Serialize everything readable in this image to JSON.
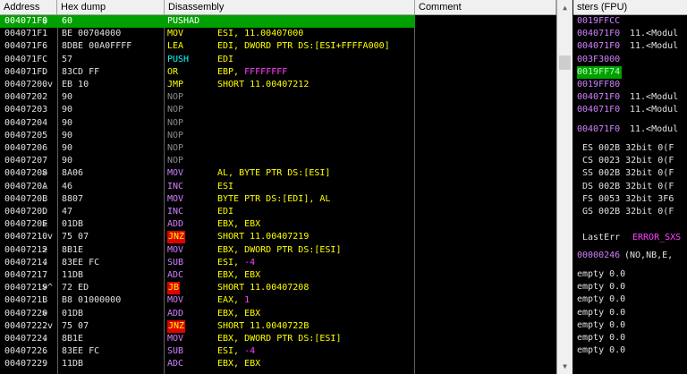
{
  "headers": {
    "address": "Address",
    "hex": "Hex dump",
    "disasm": "Disassembly",
    "comment": "Comment",
    "registers": "sters (FPU)"
  },
  "rows": [
    {
      "addr": "004071F0",
      "jmp": "$",
      "hex": "60",
      "mn": "PUSHAD",
      "mn_style": "white",
      "op": "",
      "op_style": "white",
      "selected": true
    },
    {
      "addr": "004071F1",
      "jmp": ".",
      "hex": "BE 00704000",
      "mn": "MOV",
      "mn_style": "yellow",
      "op": "ESI, 11.00407000",
      "op_style": "yellow"
    },
    {
      "addr": "004071F6",
      "jmp": ".",
      "hex": "8DBE 00A0FFFF",
      "mn": "LEA",
      "mn_style": "yellow",
      "op": "EDI, DWORD PTR DS:[ESI+FFFFA000]",
      "op_style": "yellow"
    },
    {
      "addr": "004071FC",
      "jmp": ".",
      "hex": "57",
      "mn": "PUSH",
      "mn_style": "cyan",
      "op": "EDI",
      "op_style": "yellow"
    },
    {
      "addr": "004071FD",
      "jmp": ".",
      "hex": "83CD FF",
      "mn": "OR",
      "mn_style": "yellow",
      "op": "EBP, FFFFFFFF",
      "op_style": "yellow",
      "op2": "FFFFFFFF"
    },
    {
      "addr": "00407200",
      "jmp": ".v",
      "hex": "EB 10",
      "mn": "JMP",
      "mn_style": "yellow",
      "op": "SHORT 11.00407212",
      "op_style": "yellow"
    },
    {
      "addr": "00407202",
      "jmp": "",
      "hex": "90",
      "mn": "NOP",
      "mn_style": "gray",
      "op": "",
      "op_style": "white"
    },
    {
      "addr": "00407203",
      "jmp": "",
      "hex": "90",
      "mn": "NOP",
      "mn_style": "gray",
      "op": "",
      "op_style": "white"
    },
    {
      "addr": "00407204",
      "jmp": "",
      "hex": "90",
      "mn": "NOP",
      "mn_style": "gray",
      "op": "",
      "op_style": "white"
    },
    {
      "addr": "00407205",
      "jmp": "",
      "hex": "90",
      "mn": "NOP",
      "mn_style": "gray",
      "op": "",
      "op_style": "white"
    },
    {
      "addr": "00407206",
      "jmp": "",
      "hex": "90",
      "mn": "NOP",
      "mn_style": "gray",
      "op": "",
      "op_style": "white"
    },
    {
      "addr": "00407207",
      "jmp": "",
      "hex": "90",
      "mn": "NOP",
      "mn_style": "gray",
      "op": "",
      "op_style": "white"
    },
    {
      "addr": "00407208",
      "jmp": ">",
      "hex": "8A06",
      "mn": "MOV",
      "mn_style": "purple",
      "op": "AL, BYTE PTR DS:[ESI]",
      "op_style": "yellow"
    },
    {
      "addr": "0040720A",
      "jmp": ".",
      "hex": "46",
      "mn": "INC",
      "mn_style": "purple",
      "op": "ESI",
      "op_style": "yellow"
    },
    {
      "addr": "0040720B",
      "jmp": ".",
      "hex": "8807",
      "mn": "MOV",
      "mn_style": "purple",
      "op": "BYTE PTR DS:[EDI], AL",
      "op_style": "yellow"
    },
    {
      "addr": "0040720D",
      "jmp": ".",
      "hex": "47",
      "mn": "INC",
      "mn_style": "purple",
      "op": "EDI",
      "op_style": "yellow"
    },
    {
      "addr": "0040720E",
      "jmp": ">",
      "hex": "01DB",
      "mn": "ADD",
      "mn_style": "purple",
      "op": "EBX, EBX",
      "op_style": "yellow"
    },
    {
      "addr": "00407210",
      "jmp": ".v",
      "hex": "75 07",
      "mn": "JNZ",
      "mn_style": "red",
      "op": "SHORT 11.00407219",
      "op_style": "yellow"
    },
    {
      "addr": "00407212",
      "jmp": ">",
      "hex": "8B1E",
      "mn": "MOV",
      "mn_style": "purple",
      "op": "EBX, DWORD PTR DS:[ESI]",
      "op_style": "yellow"
    },
    {
      "addr": "00407214",
      "jmp": ".",
      "hex": "83EE FC",
      "mn": "SUB",
      "mn_style": "purple",
      "op": "ESI, -4",
      "op_style": "yellow",
      "op2": "-4"
    },
    {
      "addr": "00407217",
      "jmp": ".",
      "hex": "11DB",
      "mn": "ADC",
      "mn_style": "purple",
      "op": "EBX, EBX",
      "op_style": "yellow"
    },
    {
      "addr": "00407219",
      "jmp": ">^",
      "hex": "72 ED",
      "mn": "JB",
      "mn_style": "red",
      "op": "SHORT 11.00407208",
      "op_style": "yellow"
    },
    {
      "addr": "0040721B",
      "jmp": ".",
      "hex": "B8 01000000",
      "mn": "MOV",
      "mn_style": "purple",
      "op": "EAX, 1",
      "op_style": "yellow",
      "op2": "1"
    },
    {
      "addr": "00407220",
      "jmp": ">",
      "hex": "01DB",
      "mn": "ADD",
      "mn_style": "purple",
      "op": "EBX, EBX",
      "op_style": "yellow"
    },
    {
      "addr": "00407222",
      "jmp": ".v",
      "hex": "75 07",
      "mn": "JNZ",
      "mn_style": "red",
      "op": "SHORT 11.0040722B",
      "op_style": "yellow"
    },
    {
      "addr": "00407224",
      "jmp": ".",
      "hex": "8B1E",
      "mn": "MOV",
      "mn_style": "purple",
      "op": "EBX, DWORD PTR DS:[ESI]",
      "op_style": "yellow"
    },
    {
      "addr": "00407226",
      "jmp": ".",
      "hex": "83EE FC",
      "mn": "SUB",
      "mn_style": "purple",
      "op": "ESI, -4",
      "op_style": "yellow",
      "op2": "-4"
    },
    {
      "addr": "00407229",
      "jmp": ".",
      "hex": "11DB",
      "mn": "ADC",
      "mn_style": "purple",
      "op": "EBX, EBX",
      "op_style": "yellow"
    }
  ],
  "registers": {
    "stack": [
      {
        "addr": "0019FFCC",
        "val": ""
      },
      {
        "addr": "004071F0",
        "val": "11.<Modul"
      },
      {
        "addr": "004071F0",
        "val": "11.<Modul"
      },
      {
        "addr": "003F3000",
        "val": ""
      },
      {
        "addr": "0019FF74",
        "val": "",
        "highlight": true
      },
      {
        "addr": "0019FF80",
        "val": ""
      },
      {
        "addr": "004071F0",
        "val": "11.<Modul"
      },
      {
        "addr": "004071F0",
        "val": "11.<Modul"
      },
      {
        "addr": "004071F0",
        "val": "11.<Modul"
      }
    ],
    "segments": [
      "ES 002B 32bit 0(F",
      "CS 0023 32bit 0(F",
      "SS 002B 32bit 0(F",
      "DS 002B 32bit 0(F",
      "FS 0053 32bit 3F6",
      "GS 002B 32bit 0(F"
    ],
    "lasterr_label": "LastErr",
    "lasterr_value": "ERROR_SXS",
    "flags_value": "00000246",
    "flags_text": "(NO,NB,E,",
    "fpu": [
      "empty 0.0",
      "empty 0.0",
      "empty 0.0",
      "empty 0.0",
      "empty 0.0",
      "empty 0.0",
      "empty 0.0"
    ]
  },
  "colors": {
    "selection": "#00a000",
    "yellow": "#ffff00",
    "purple": "#d080ff",
    "magenta": "#ff40ff",
    "red": "#e00000"
  }
}
